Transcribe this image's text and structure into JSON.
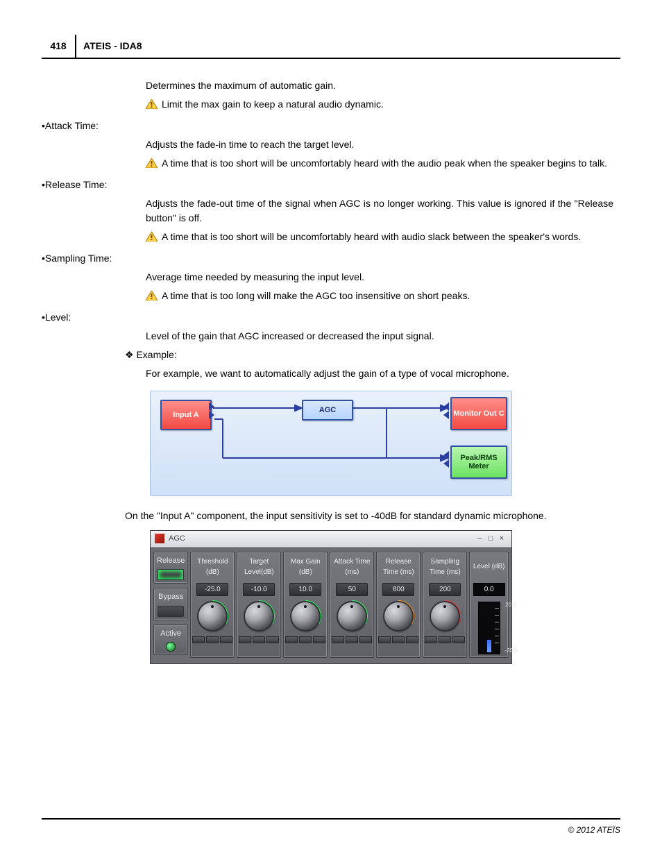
{
  "header": {
    "page_number": "418",
    "title": "ATEIS - IDA8"
  },
  "intro_line": "Determines the maximum of automatic gain.",
  "intro_warn": "Limit the max gain to keep a natural audio dynamic.",
  "items": [
    {
      "name": "Attack Time:",
      "desc": "Adjusts the fade-in time to reach the target level.",
      "warn": "A time that is too short will be uncomfortably heard with the audio peak when the speaker begins to talk."
    },
    {
      "name": "Release Time:",
      "desc": "Adjusts the fade-out time of the signal when AGC is no longer working. This value is ignored if the \"Release button\" is off.",
      "warn": "A time that is too short will be uncomfortably heard with audio slack between the speaker's words."
    },
    {
      "name": "Sampling Time:",
      "desc": "Average time needed by measuring the input level.",
      "warn": "A time that is too long will make the AGC too insensitive on short peaks."
    },
    {
      "name": "Level:",
      "desc": "Level of the gain that AGC  increased or decreased the input signal.",
      "warn": null
    }
  ],
  "example_heading": "Example:",
  "example_text": "For example, we want to automatically adjust the gain of a type of vocal microphone.",
  "diagram": {
    "nodes": {
      "input": "Input A",
      "agc": "AGC",
      "monitor": "Monitor Out C",
      "meter": "Peak/RMS Meter"
    }
  },
  "after_diagram": "On the \"Input A\" component, the input sensitivity is set to -40dB for standard dynamic microphone.",
  "agc_panel": {
    "title": "AGC",
    "side": {
      "release": "Release",
      "bypass": "Bypass",
      "active": "Active"
    },
    "columns": [
      {
        "label": "Threshold (dB)",
        "value": "-25.0",
        "ring": "g"
      },
      {
        "label": "Target Level(dB)",
        "value": "-10.0",
        "ring": "g"
      },
      {
        "label": "Max Gain (dB)",
        "value": "10.0",
        "ring": "g"
      },
      {
        "label": "Attack Time (ms)",
        "value": "50",
        "ring": "g"
      },
      {
        "label": "Release Time (ms)",
        "value": "800",
        "ring": "o"
      },
      {
        "label": "Sampling Time (ms)",
        "value": "200",
        "ring": "r"
      }
    ],
    "level": {
      "label": "Level (dB)",
      "top": "0.0",
      "hi": "20.0",
      "lo": "-20.0"
    }
  },
  "footer": "© 2012 ATEÏS"
}
